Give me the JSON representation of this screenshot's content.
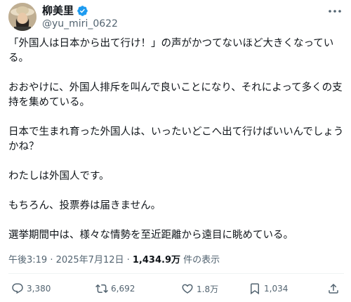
{
  "author": {
    "display_name": "柳美里",
    "handle": "@yu_miri_0622"
  },
  "tweet": {
    "paragraphs": [
      "「外国人は日本から出て行け！」の声がかつてないほど大きくなっている。",
      "おおやけに、外国人排斥を叫んで良いことになり、それによって多くの支持を集めている。",
      "日本で生まれ育った外国人は、いったいどこへ出て行けばいいんでしょうかね？",
      "わたしは外国人です。",
      "もちろん、投票券は届きません。",
      "選挙期間中は、様々な情勢を至近距離から遠目に眺めている。"
    ],
    "timestamp": "午後3:19 · 2025年7月12日 · ",
    "views_count": "1,434.9万",
    "views_suffix": " 件の表示"
  },
  "actions": {
    "replies": "3,380",
    "reposts": "6,692",
    "likes": "1.8万",
    "bookmarks": "1,034"
  },
  "colors": {
    "text": "#0f1419",
    "secondary": "#536471",
    "verified": "#1d9bf0",
    "divider": "#eff3f4"
  }
}
